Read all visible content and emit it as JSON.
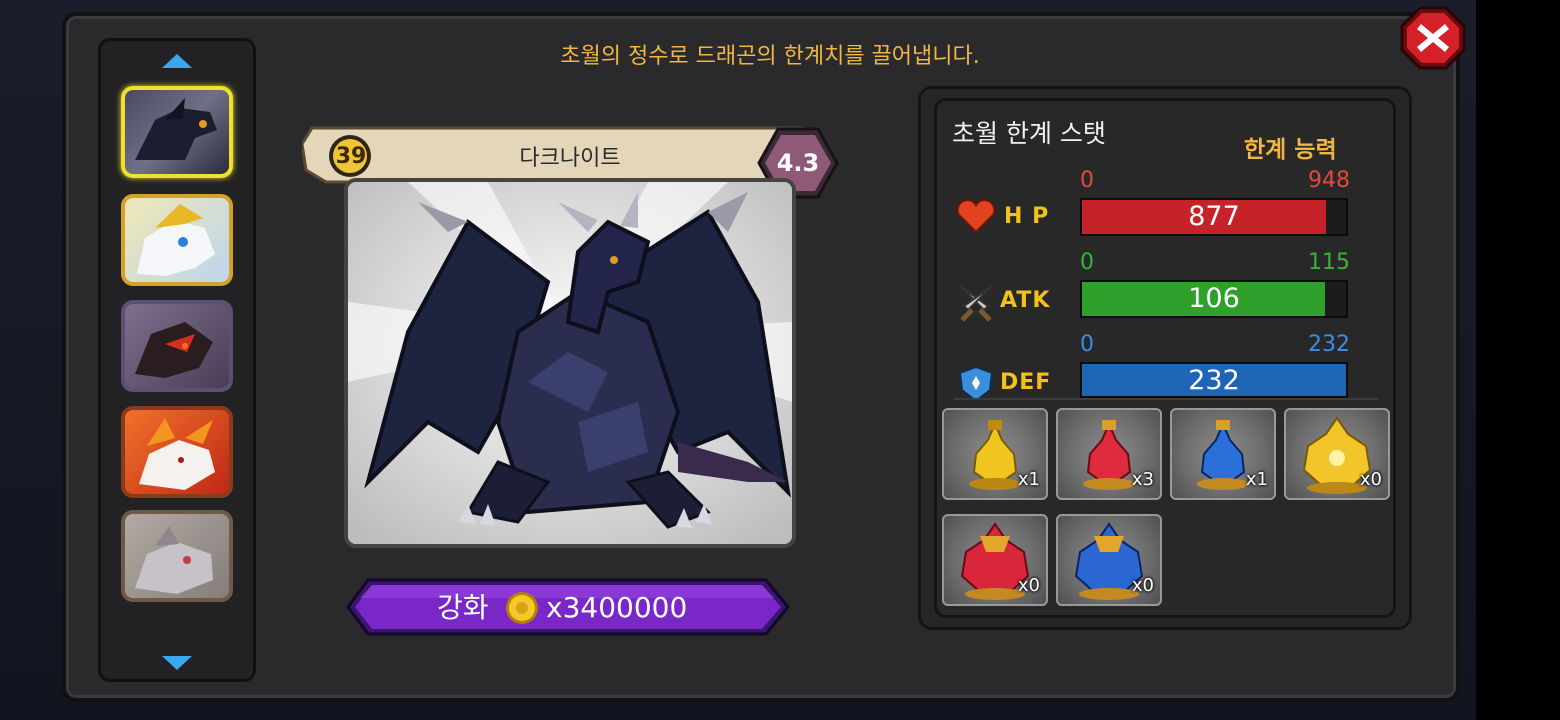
{
  "header": {
    "description": "초월의 정수로 드래곤의 한계치를 끌어냅니다."
  },
  "sidebar": {
    "thumbnails": [
      {
        "name": "dark-knight-dragon",
        "selected": true
      },
      {
        "name": "white-gold-dragon",
        "selected": false
      },
      {
        "name": "shadow-fire-dragon",
        "selected": false
      },
      {
        "name": "flame-dragon",
        "selected": false
      },
      {
        "name": "grey-rock-dragon",
        "selected": false
      }
    ]
  },
  "dragon": {
    "level": "39",
    "name": "다크나이트",
    "grade": "4.3"
  },
  "upgrade": {
    "label": "강화",
    "cost": "x3400000"
  },
  "stats": {
    "title": "초월 한계 스탯",
    "limit_title": "한계 능력",
    "rows": [
      {
        "label": "H P",
        "min": "0",
        "max": "948",
        "value": "877",
        "fill": 0.925,
        "color": "#c6222a",
        "text_color": "#e24b3c"
      },
      {
        "label": "ATK",
        "min": "0",
        "max": "115",
        "value": "106",
        "fill": 0.922,
        "color": "#2fa02c",
        "text_color": "#38b33a"
      },
      {
        "label": "DEF",
        "min": "0",
        "max": "232",
        "value": "232",
        "fill": 1.0,
        "color": "#1f65b5",
        "text_color": "#3a8ee8"
      }
    ]
  },
  "items": [
    {
      "name": "yellow-essence-small",
      "count": "x1"
    },
    {
      "name": "red-essence-small",
      "count": "x3"
    },
    {
      "name": "blue-essence-small",
      "count": "x1"
    },
    {
      "name": "gold-essence-large",
      "count": "x0"
    },
    {
      "name": "red-essence-large",
      "count": "x0"
    },
    {
      "name": "blue-essence-large",
      "count": "x0"
    }
  ]
}
